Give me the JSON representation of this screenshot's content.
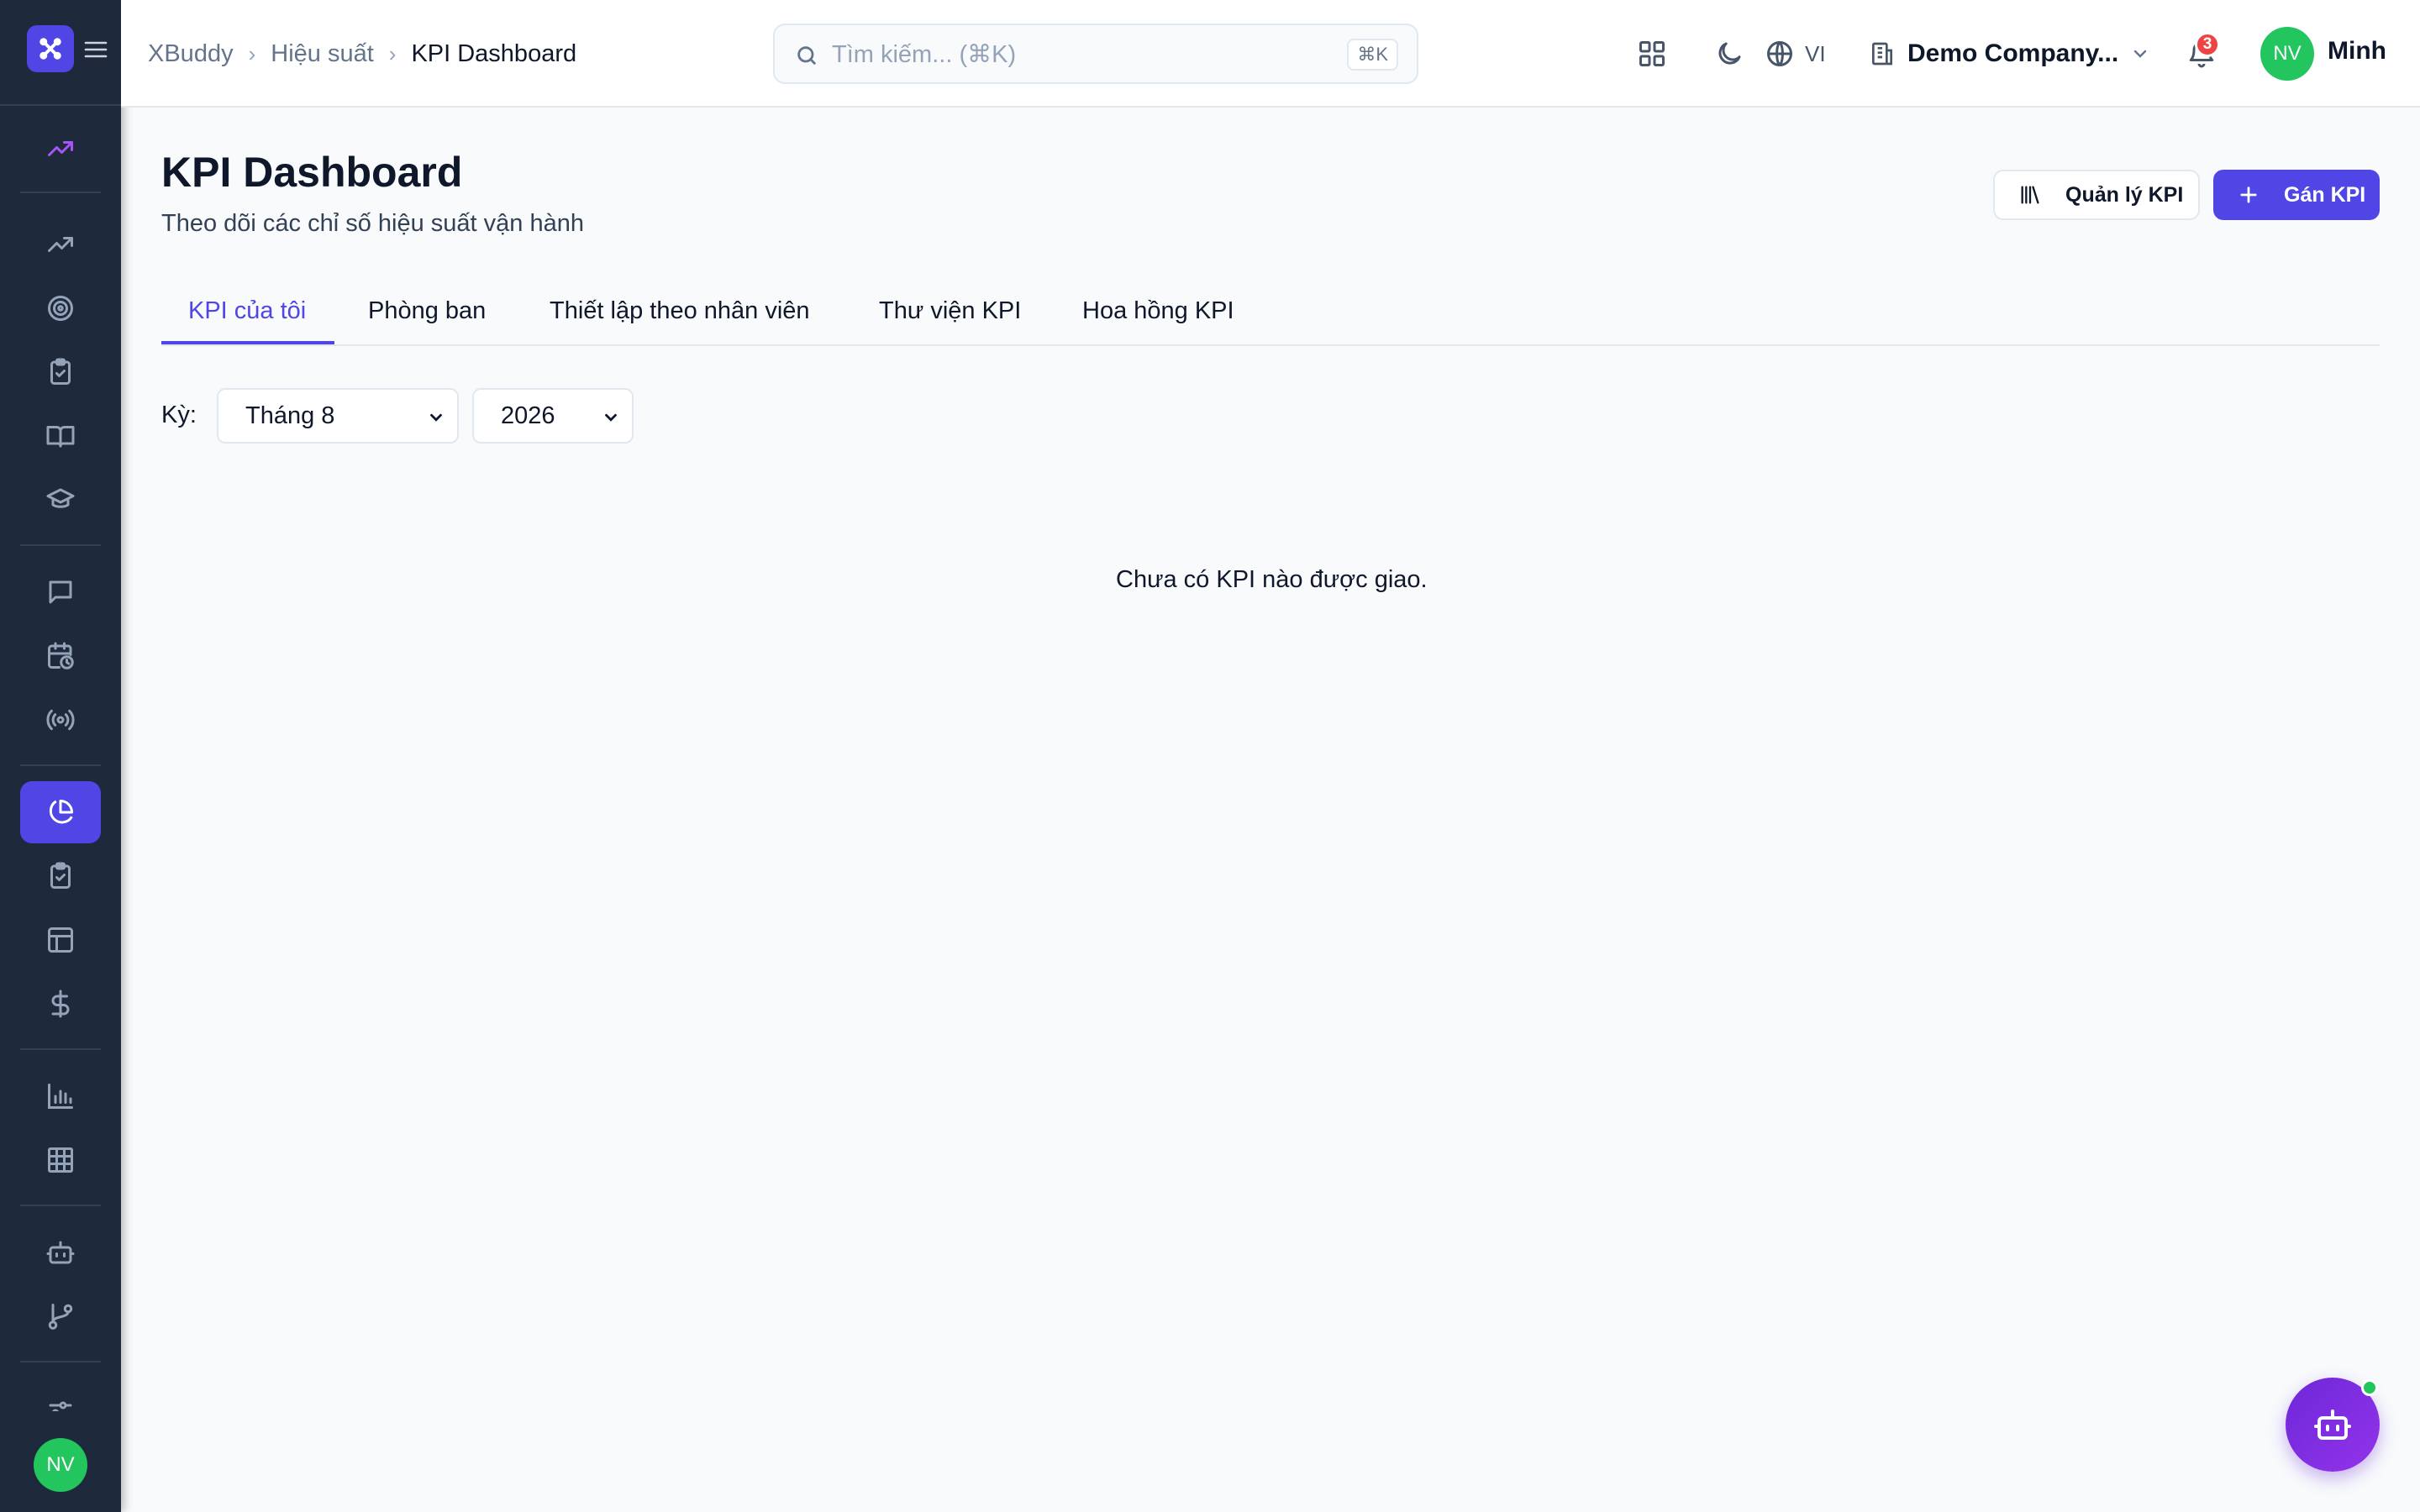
{
  "app": {
    "logo_name": "XBuddy"
  },
  "breadcrumb": {
    "root": "XBuddy",
    "section": "Hiệu suất",
    "current": "KPI Dashboard"
  },
  "search": {
    "placeholder": "Tìm kiếm... (⌘K)",
    "shortcut": "⌘K"
  },
  "topbar": {
    "language": "VI",
    "company": "Demo Company...",
    "notification_count": "3",
    "user_initials": "NV",
    "user_name": "Minh"
  },
  "page": {
    "title": "KPI Dashboard",
    "subtitle": "Theo dõi các chỉ số hiệu suất vận hành",
    "manage_button": "Quản lý KPI",
    "assign_button": "Gán KPI"
  },
  "tabs": [
    {
      "label": "KPI của tôi",
      "active": true
    },
    {
      "label": "Phòng ban",
      "active": false
    },
    {
      "label": "Thiết lập theo nhân viên",
      "active": false
    },
    {
      "label": "Thư viện KPI",
      "active": false
    },
    {
      "label": "Hoa hồng KPI",
      "active": false
    }
  ],
  "filters": {
    "period_label": "Kỳ:",
    "month": "Tháng 8",
    "year": "2026"
  },
  "empty_state": "Chưa có KPI nào được giao.",
  "sidebar": {
    "user_initials": "NV",
    "active_item": "pie-chart-icon",
    "icons": [
      "trending-up-icon",
      "trending-up-icon",
      "target-icon",
      "clipboard-check-icon",
      "book-open-icon",
      "graduation-cap-icon",
      "message-square-icon",
      "calendar-clock-icon",
      "radio-icon",
      "pie-chart-icon",
      "clipboard-check-icon",
      "layout-icon",
      "dollar-icon",
      "bar-chart-icon",
      "grid-icon",
      "bot-icon",
      "git-branch-icon",
      "sliders-icon"
    ]
  },
  "colors": {
    "accent": "#4f46e5",
    "sidebar": "#1e293b",
    "success": "#22c55e",
    "danger": "#ef4444"
  }
}
